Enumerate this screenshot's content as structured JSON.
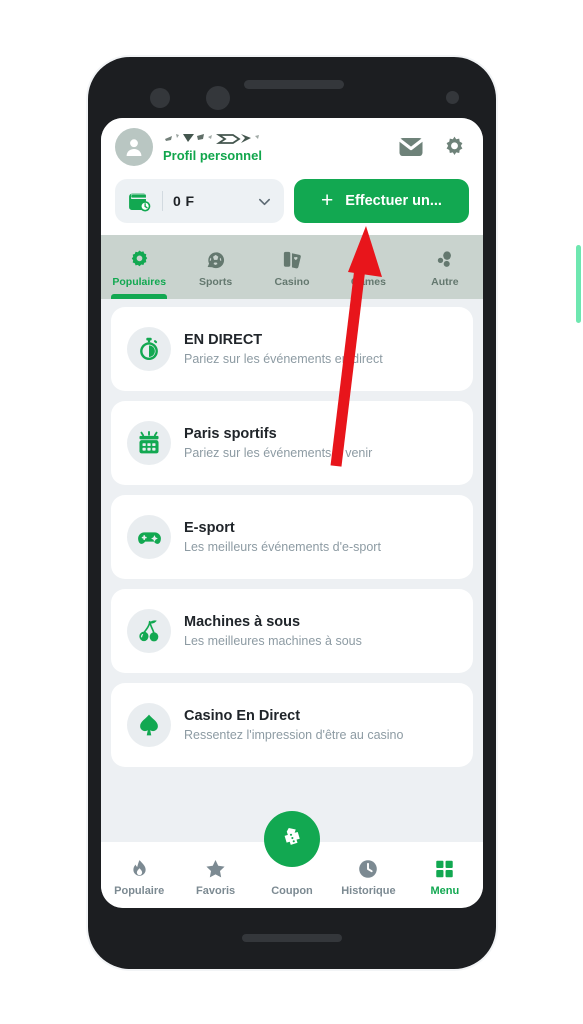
{
  "app": {
    "accent_green": "#12A851",
    "tabbar_bg": "#C9D3CE",
    "screen_bg": "#EDF0F3",
    "muted_text": "#8D9BA3",
    "phone_bezel": "#1C1E21"
  },
  "header": {
    "avatar_icon": "person-avatar-icon",
    "username_redacted": true,
    "profile_label": "Profil personnel",
    "mail_icon": "envelope-icon",
    "settings_icon": "gear-icon"
  },
  "balance": {
    "wallet_icon": "wallet-icon",
    "amount": "0 F",
    "chevron_icon": "chevron-down-icon"
  },
  "deposit": {
    "plus": "+",
    "label": "Effectuer un..."
  },
  "tabs": [
    {
      "label": "Populaires",
      "icon": "flower-star-icon",
      "active": true
    },
    {
      "label": "Sports",
      "icon": "football-icon",
      "active": false
    },
    {
      "label": "Casino",
      "icon": "playing-cards-icon",
      "active": false
    },
    {
      "label": "Games",
      "icon": "dice-icon",
      "active": false
    },
    {
      "label": "Autre",
      "icon": "dots-cluster-icon",
      "active": false
    }
  ],
  "cards": [
    {
      "title": "EN DIRECT",
      "subtitle": "Pariez sur les événements en direct",
      "icon": "stopwatch-icon"
    },
    {
      "title": "Paris sportifs",
      "subtitle": "Pariez sur les événements à venir",
      "icon": "calendar-icon"
    },
    {
      "title": "E-sport",
      "subtitle": "Les meilleurs événements d'e-sport",
      "icon": "gamepad-icon"
    },
    {
      "title": "Machines à sous",
      "subtitle": "Les meilleures machines à sous",
      "icon": "cherries-icon"
    },
    {
      "title": "Casino En Direct",
      "subtitle": "Ressentez l'impression d'être au casino",
      "icon": "spade-icon"
    }
  ],
  "bottom_nav": [
    {
      "label": "Populaire",
      "icon": "flame-icon",
      "active": false
    },
    {
      "label": "Favoris",
      "icon": "star-icon",
      "active": false
    },
    {
      "label": "Coupon",
      "icon": "ticket-icon",
      "active": false
    },
    {
      "label": "Historique",
      "icon": "clock-icon",
      "active": false
    },
    {
      "label": "Menu",
      "icon": "grid-icon",
      "active": true
    }
  ],
  "annotation": {
    "arrow_color": "#E8151B",
    "points_to": "deposit-button"
  }
}
